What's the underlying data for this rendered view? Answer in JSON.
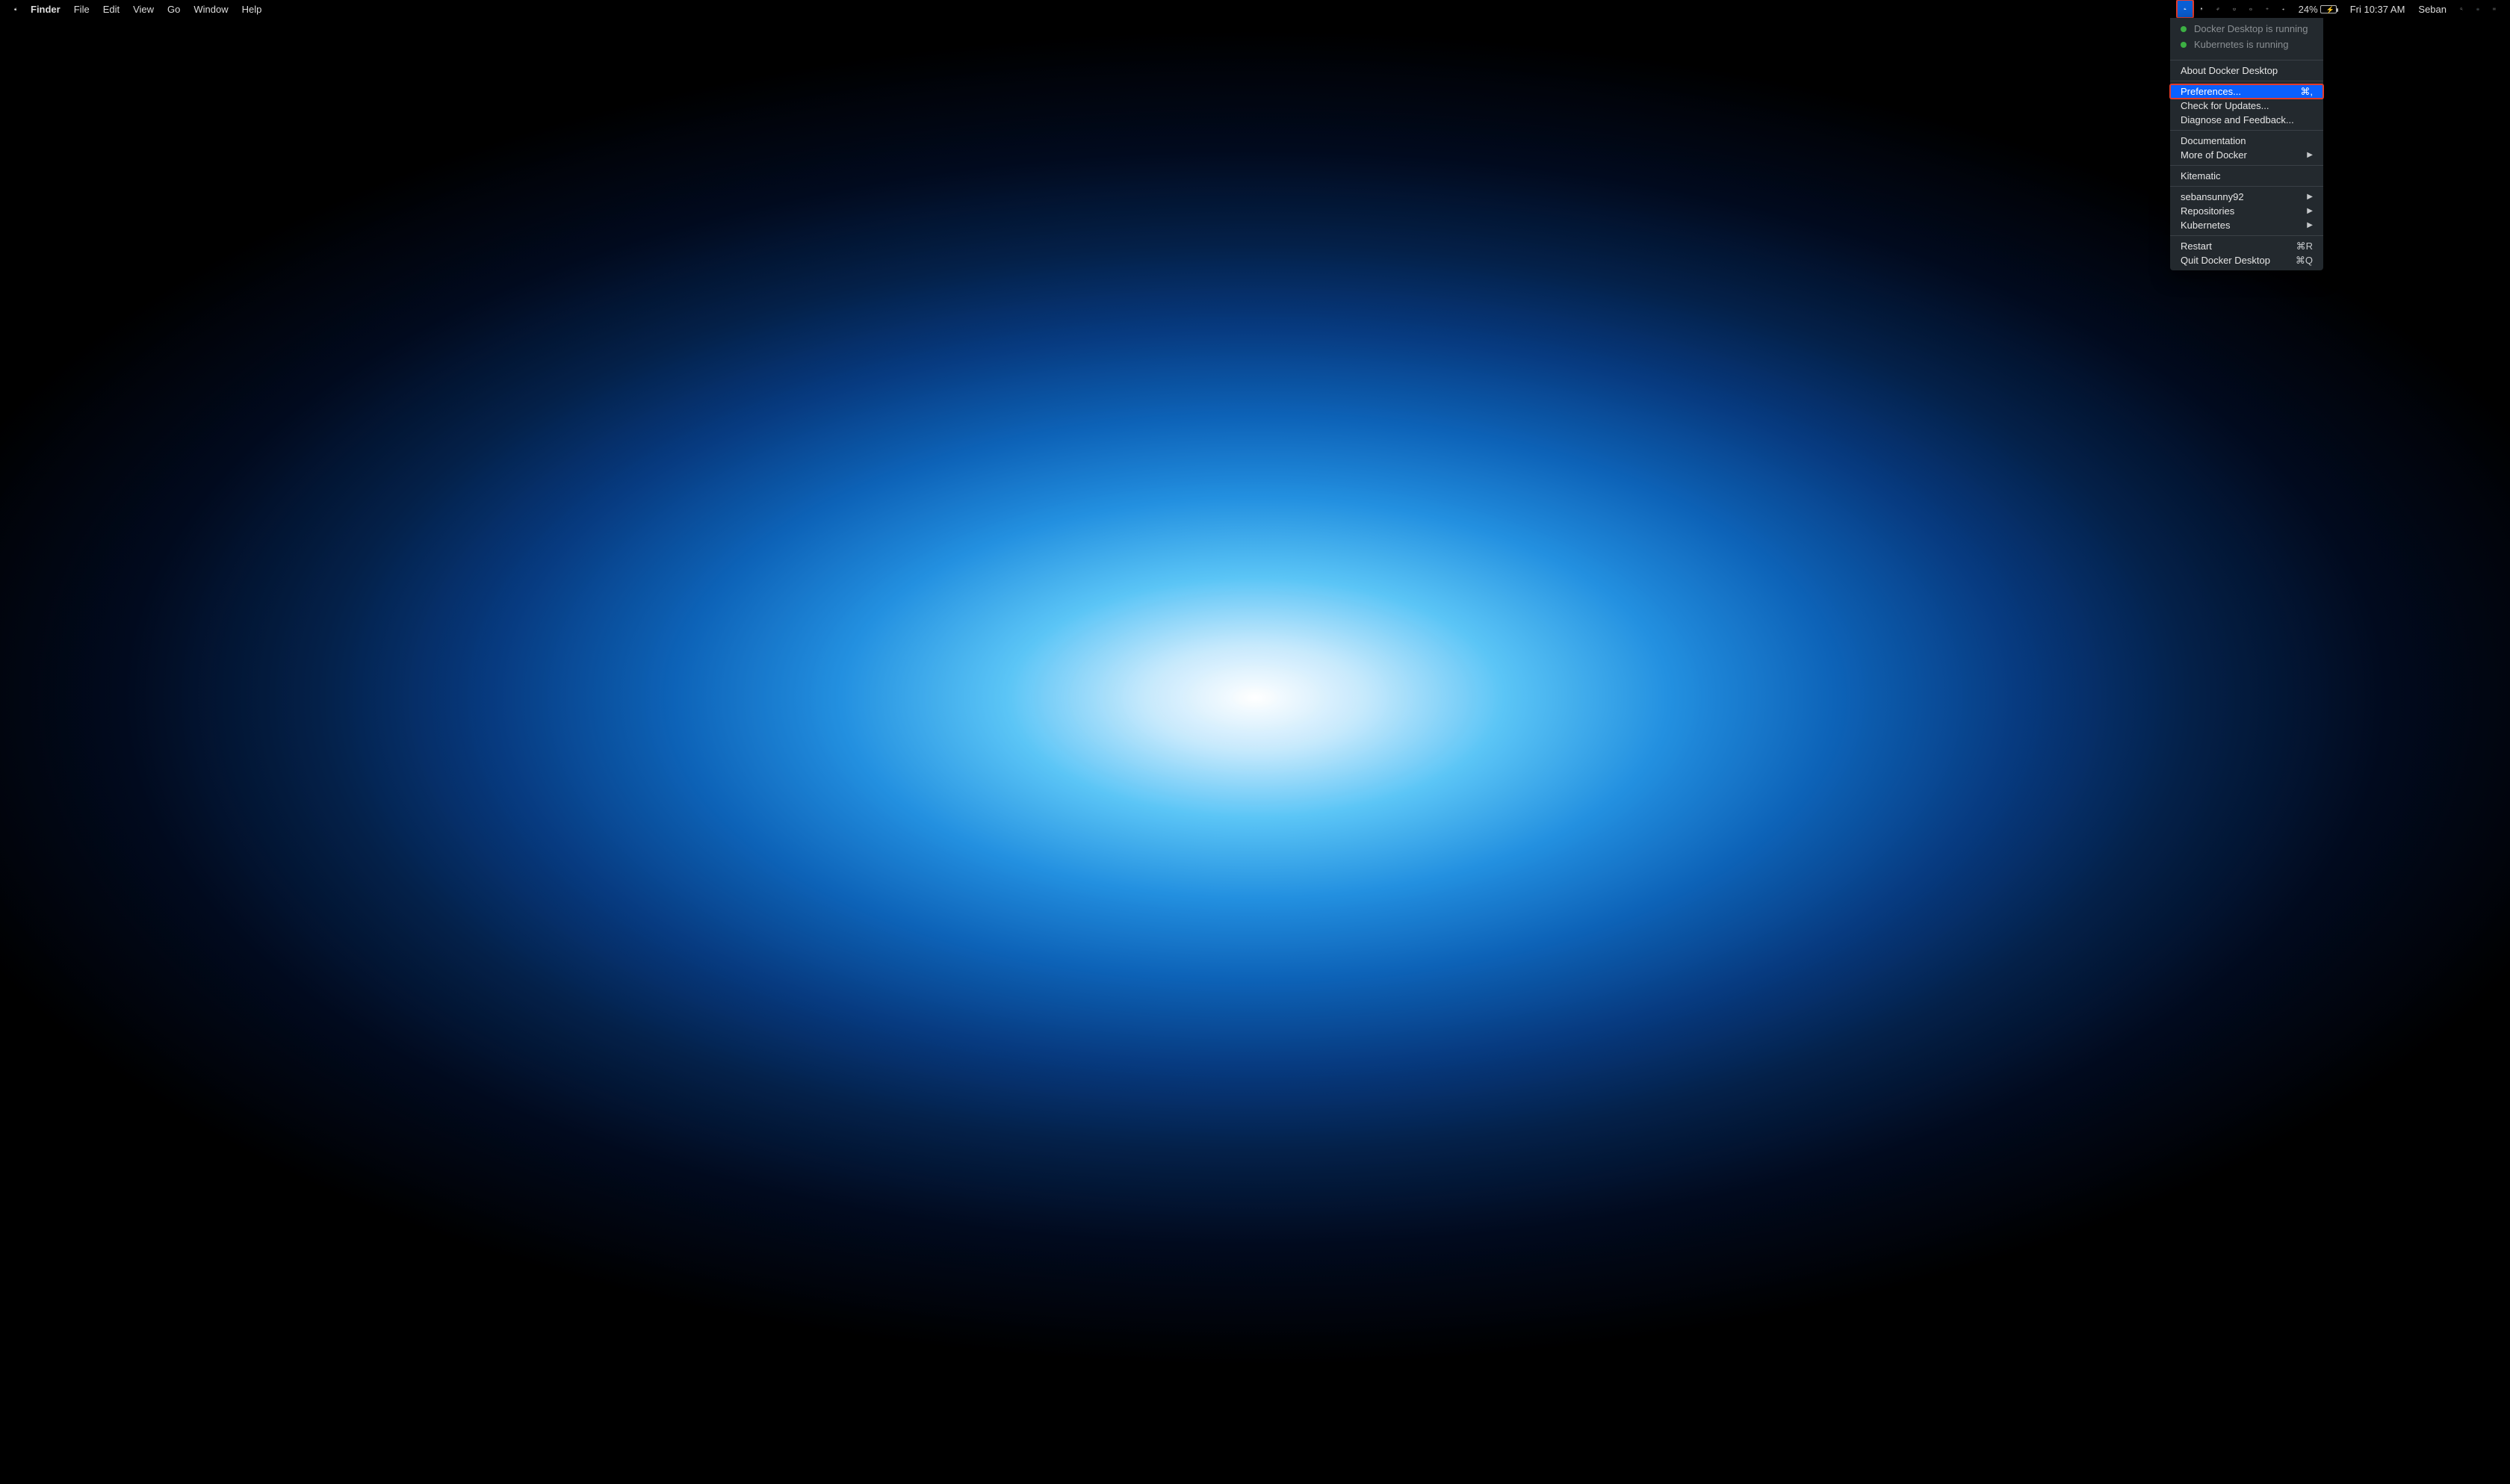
{
  "menubar": {
    "app_name": "Finder",
    "items": [
      "File",
      "Edit",
      "View",
      "Go",
      "Window",
      "Help"
    ],
    "battery_percent": "24%",
    "time": "Fri 10:37 AM",
    "user": "Seban"
  },
  "docker_menu": {
    "status": [
      "Docker Desktop is running",
      "Kubernetes is running"
    ],
    "sections": [
      [
        {
          "label": "About Docker Desktop"
        }
      ],
      [
        {
          "label": "Preferences...",
          "shortcut": "⌘,",
          "selected": true
        },
        {
          "label": "Check for Updates..."
        },
        {
          "label": "Diagnose and Feedback..."
        }
      ],
      [
        {
          "label": "Documentation"
        },
        {
          "label": "More of Docker",
          "submenu": true
        }
      ],
      [
        {
          "label": "Kitematic"
        }
      ],
      [
        {
          "label": "sebansunny92",
          "submenu": true
        },
        {
          "label": "Repositories",
          "submenu": true
        },
        {
          "label": "Kubernetes",
          "submenu": true
        }
      ],
      [
        {
          "label": "Restart",
          "shortcut": "⌘R"
        },
        {
          "label": "Quit Docker Desktop",
          "shortcut": "⌘Q"
        }
      ]
    ]
  }
}
